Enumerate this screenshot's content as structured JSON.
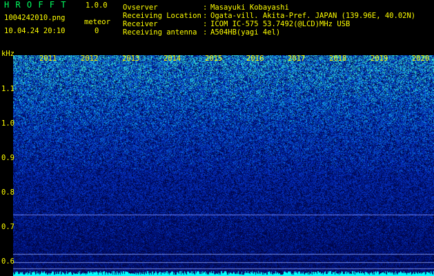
{
  "app": {
    "title": "H R O F F T",
    "version": "1.0.0"
  },
  "file": {
    "name": "1004242010.png",
    "datetime": "10.04.24 20:10"
  },
  "meteor": {
    "label": "meteor",
    "count": "0"
  },
  "info": [
    {
      "label": "Ovserver",
      "value": "Masayuki Kobayashi"
    },
    {
      "label": "Receiving Location",
      "value": "Ogata-vill. Akita-Pref. JAPAN (139.96E, 40.02N)"
    },
    {
      "label": "Receiver",
      "value": "ICOM IC-575 53.7492(@LCD)MHz USB"
    },
    {
      "label": "Receiving antenna",
      "value": "A504HB(yagi 4el)"
    }
  ],
  "axis": {
    "unit": "kHz",
    "ticks": [
      "1.1",
      "1.0",
      "0.9",
      "0.8",
      "0.7",
      "0.6"
    ],
    "years": [
      "2011",
      "2012",
      "2013",
      "2014",
      "2015",
      "2016",
      "2017",
      "2018",
      "2019",
      "2020"
    ]
  },
  "colors": {
    "background": "#000000",
    "label": "#ffff00",
    "title": "#00ff60",
    "signal": "#00ffff"
  }
}
